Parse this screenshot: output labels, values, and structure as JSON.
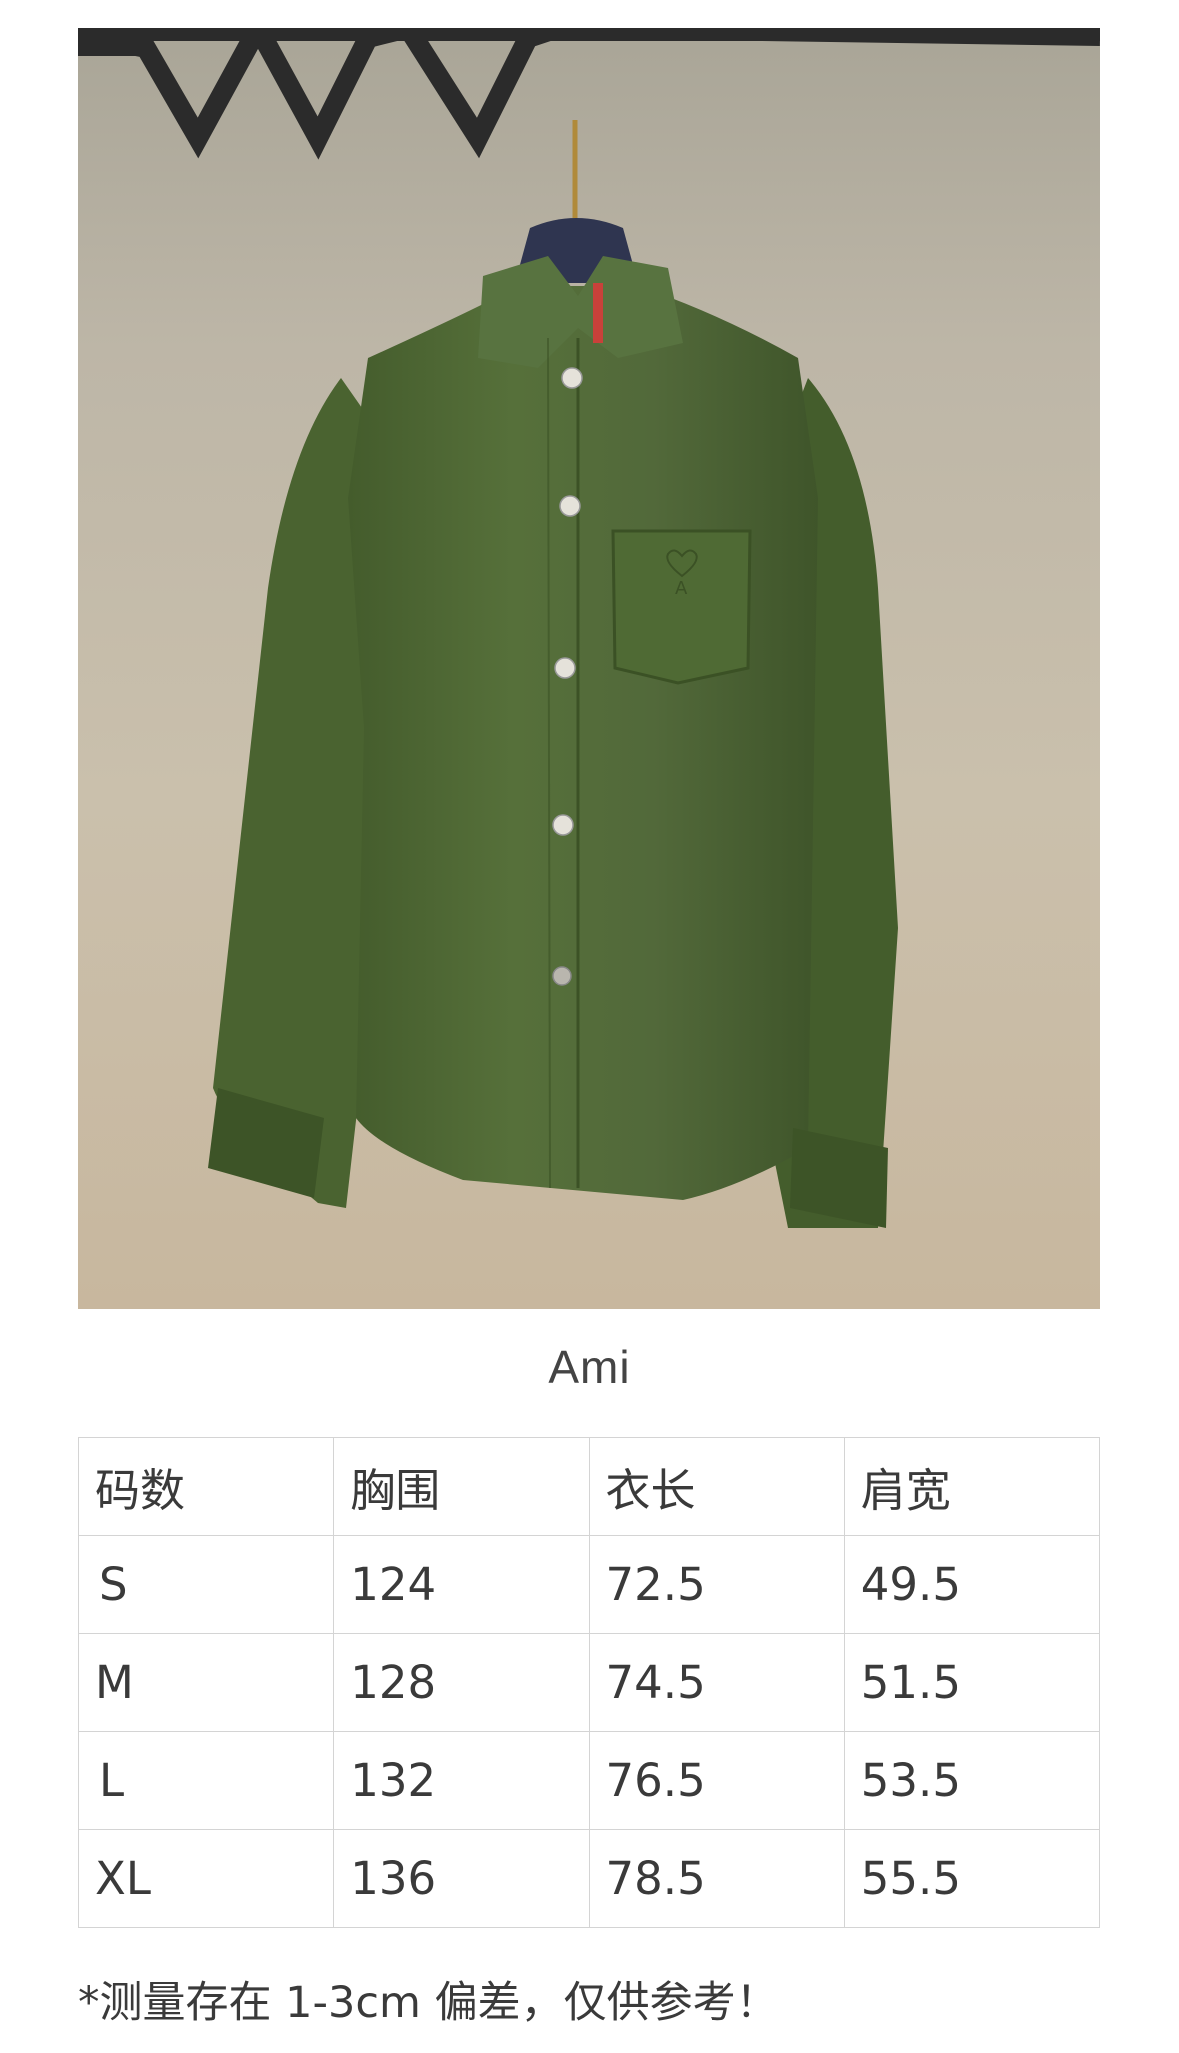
{
  "product": {
    "image_subject": "olive green overshirt with AMI heart logo on chest pocket, hanging on rack",
    "color": "#4f6a34",
    "background_color": "#c4bcab"
  },
  "brand": {
    "name": "Ami"
  },
  "size_table": {
    "headers": [
      "码数",
      "胸围",
      "衣长",
      "肩宽"
    ],
    "rows": [
      [
        "S",
        "124",
        "72.5",
        "49.5"
      ],
      [
        "M",
        "128",
        "74.5",
        "51.5"
      ],
      [
        "L",
        "132",
        "76.5",
        "53.5"
      ],
      [
        "XL",
        "136",
        "78.5",
        "55.5"
      ]
    ]
  },
  "note": {
    "text": "*测量存在 1-3cm 偏差，仅供参考！"
  }
}
